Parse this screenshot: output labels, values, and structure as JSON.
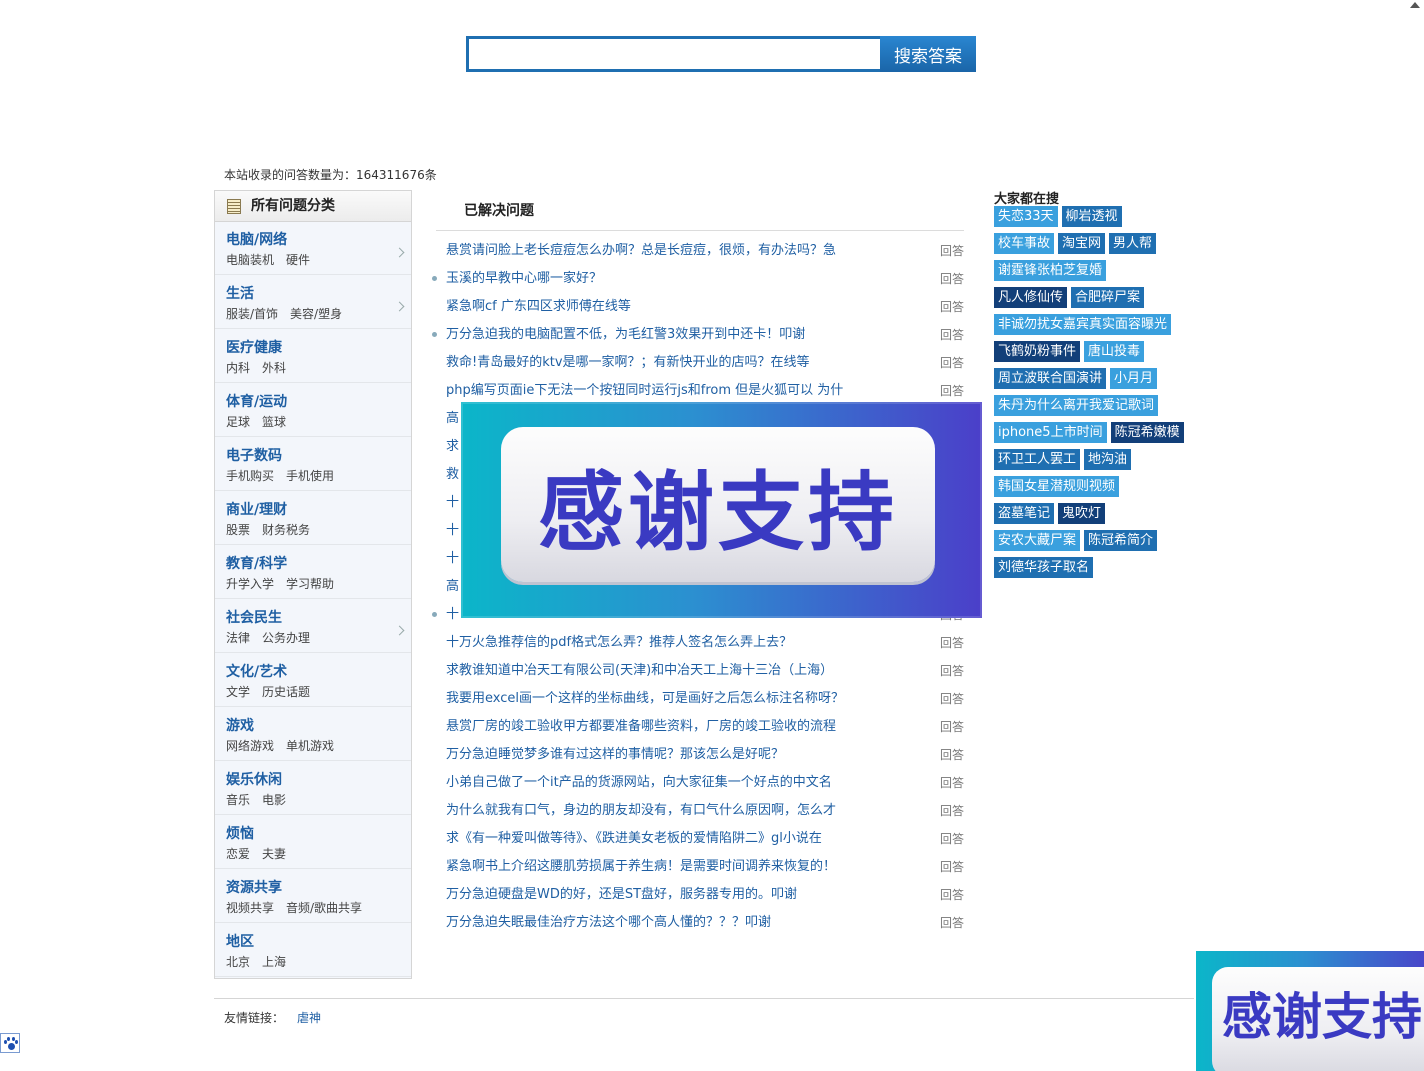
{
  "search": {
    "value": "",
    "placeholder": "",
    "button_label": "搜索答案"
  },
  "site_count": "本站收录的问答数量为：164311676条",
  "categories": {
    "header": "所有问题分类",
    "items": [
      {
        "title": "电脑/网络",
        "subs": [
          "电脑装机",
          "硬件"
        ],
        "has_arrow": true
      },
      {
        "title": "生活",
        "subs": [
          "服装/首饰",
          "美容/塑身"
        ],
        "has_arrow": true
      },
      {
        "title": "医疗健康",
        "subs": [
          "内科",
          "外科"
        ],
        "has_arrow": false
      },
      {
        "title": "体育/运动",
        "subs": [
          "足球",
          "篮球"
        ],
        "has_arrow": false
      },
      {
        "title": "电子数码",
        "subs": [
          "手机购买",
          "手机使用"
        ],
        "has_arrow": false
      },
      {
        "title": "商业/理财",
        "subs": [
          "股票",
          "财务税务"
        ],
        "has_arrow": false
      },
      {
        "title": "教育/科学",
        "subs": [
          "升学入学",
          "学习帮助"
        ],
        "has_arrow": false
      },
      {
        "title": "社会民生",
        "subs": [
          "法律",
          "公务办理"
        ],
        "has_arrow": true
      },
      {
        "title": "文化/艺术",
        "subs": [
          "文学",
          "历史话题"
        ],
        "has_arrow": false
      },
      {
        "title": "游戏",
        "subs": [
          "网络游戏",
          "单机游戏"
        ],
        "has_arrow": false
      },
      {
        "title": "娱乐休闲",
        "subs": [
          "音乐",
          "电影"
        ],
        "has_arrow": false
      },
      {
        "title": "烦恼",
        "subs": [
          "恋爱",
          "夫妻"
        ],
        "has_arrow": false
      },
      {
        "title": "资源共享",
        "subs": [
          "视频共享",
          "音频/歌曲共享"
        ],
        "has_arrow": false
      },
      {
        "title": "地区",
        "subs": [
          "北京",
          "上海"
        ],
        "has_arrow": false
      }
    ]
  },
  "solved": {
    "title": "已解决问题",
    "tag_label": "回答",
    "questions": [
      {
        "text": "悬赏请问脸上老长痘痘怎么办啊？总是长痘痘，很烦，有办法吗？急",
        "dot": false
      },
      {
        "text": "玉溪的早教中心哪一家好？",
        "dot": true
      },
      {
        "text": "紧急啊cf 广东四区求师傅在线等",
        "dot": false
      },
      {
        "text": "万分急迫我的电脑配置不低，为毛红警3效果开到中还卡！叩谢",
        "dot": true
      },
      {
        "text": "救命!青岛最好的ktv是哪一家啊？；有新快开业的店吗？在线等",
        "dot": false
      },
      {
        "text": "php编写页面ie下无法一个按钮同时运行js和from 但是火狐可以 为什",
        "dot": false
      },
      {
        "text": "高",
        "dot": false
      },
      {
        "text": "求",
        "dot": false
      },
      {
        "text": "救",
        "dot": false
      },
      {
        "text": "十",
        "dot": false
      },
      {
        "text": "十",
        "dot": false
      },
      {
        "text": "十",
        "dot": false
      },
      {
        "text": "高",
        "dot": false
      },
      {
        "text": "十",
        "dot": true
      },
      {
        "text": "十万火急推荐信的pdf格式怎么弄？推荐人签名怎么弄上去？",
        "dot": false
      },
      {
        "text": "求教谁知道中冶天工有限公司(天津)和中冶天工上海十三冶（上海）",
        "dot": false
      },
      {
        "text": "我要用excel画一个这样的坐标曲线，可是画好之后怎么标注名称呀？",
        "dot": false
      },
      {
        "text": "悬赏厂房的竣工验收甲方都要准备哪些资料，厂房的竣工验收的流程",
        "dot": false
      },
      {
        "text": "万分急迫睡觉梦多谁有过这样的事情呢？那该怎么是好呢？",
        "dot": false
      },
      {
        "text": "小弟自己做了一个it产品的货源网站，向大家征集一个好点的中文名",
        "dot": false
      },
      {
        "text": "为什么就我有口气，身边的朋友却没有，有口气什么原因啊，怎么才",
        "dot": false
      },
      {
        "text": "求《有一种爱叫做等待》、《跌进美女老板的爱情陷阱二》gl小说在",
        "dot": false
      },
      {
        "text": "紧急啊书上介绍这腰肌劳损属于养生病！是需要时间调养来恢复的！",
        "dot": false
      },
      {
        "text": "万分急迫硬盘是WD的好，还是ST盘好，服务器专用的。叩谢",
        "dot": false
      },
      {
        "text": "万分急迫失眠最佳治疗方法这个哪个高人懂的？？？叩谢",
        "dot": false
      }
    ]
  },
  "banner": {
    "text": "感谢支持",
    "corner_text": "感谢支持"
  },
  "hot": {
    "title": "大家都在搜",
    "rows": [
      [
        {
          "label": "失恋33天",
          "color": "#3aa0de"
        },
        {
          "label": "柳岩透视",
          "color": "#1f6fb1"
        }
      ],
      [
        {
          "label": "校车事故",
          "color": "#3aa0de"
        },
        {
          "label": "淘宝网",
          "color": "#1f6fb1"
        },
        {
          "label": "男人帮",
          "color": "#1f6fb1"
        }
      ],
      [
        {
          "label": "谢霆锋张柏芝复婚",
          "color": "#3aa0de"
        }
      ],
      [
        {
          "label": "凡人修仙传",
          "color": "#123f79"
        },
        {
          "label": "合肥碎尸案",
          "color": "#1f6fb1"
        }
      ],
      [
        {
          "label": "非诚勿扰女嘉宾真实面容曝光",
          "color": "#3aa0de"
        }
      ],
      [
        {
          "label": "飞鹤奶粉事件",
          "color": "#123f79"
        },
        {
          "label": "唐山投毒",
          "color": "#3aa0de"
        }
      ],
      [
        {
          "label": "周立波联合国演讲",
          "color": "#1f6fb1"
        },
        {
          "label": "小月月",
          "color": "#3aa0de"
        }
      ],
      [
        {
          "label": "朱丹为什么离开我爱记歌词",
          "color": "#3aa0de"
        }
      ],
      [
        {
          "label": "iphone5上市时间",
          "color": "#3aa0de"
        },
        {
          "label": "陈冠希嫩模",
          "color": "#123f79"
        }
      ],
      [
        {
          "label": "环卫工人罢工",
          "color": "#1f6fb1"
        },
        {
          "label": "地沟油",
          "color": "#1f6fb1"
        }
      ],
      [
        {
          "label": "韩国女星潜规则视频",
          "color": "#3aa0de"
        }
      ],
      [
        {
          "label": "盗墓笔记",
          "color": "#1f6fb1"
        },
        {
          "label": "鬼吹灯",
          "color": "#123f79"
        }
      ],
      [
        {
          "label": "安农大藏尸案",
          "color": "#3aa0de"
        },
        {
          "label": "陈冠希简介",
          "color": "#1f6fb1"
        }
      ],
      [
        {
          "label": "刘德华孩子取名",
          "color": "#1f6fb1"
        }
      ]
    ]
  },
  "footer": {
    "friend_label": "友情链接：",
    "friend_links": [
      "虐神"
    ]
  }
}
